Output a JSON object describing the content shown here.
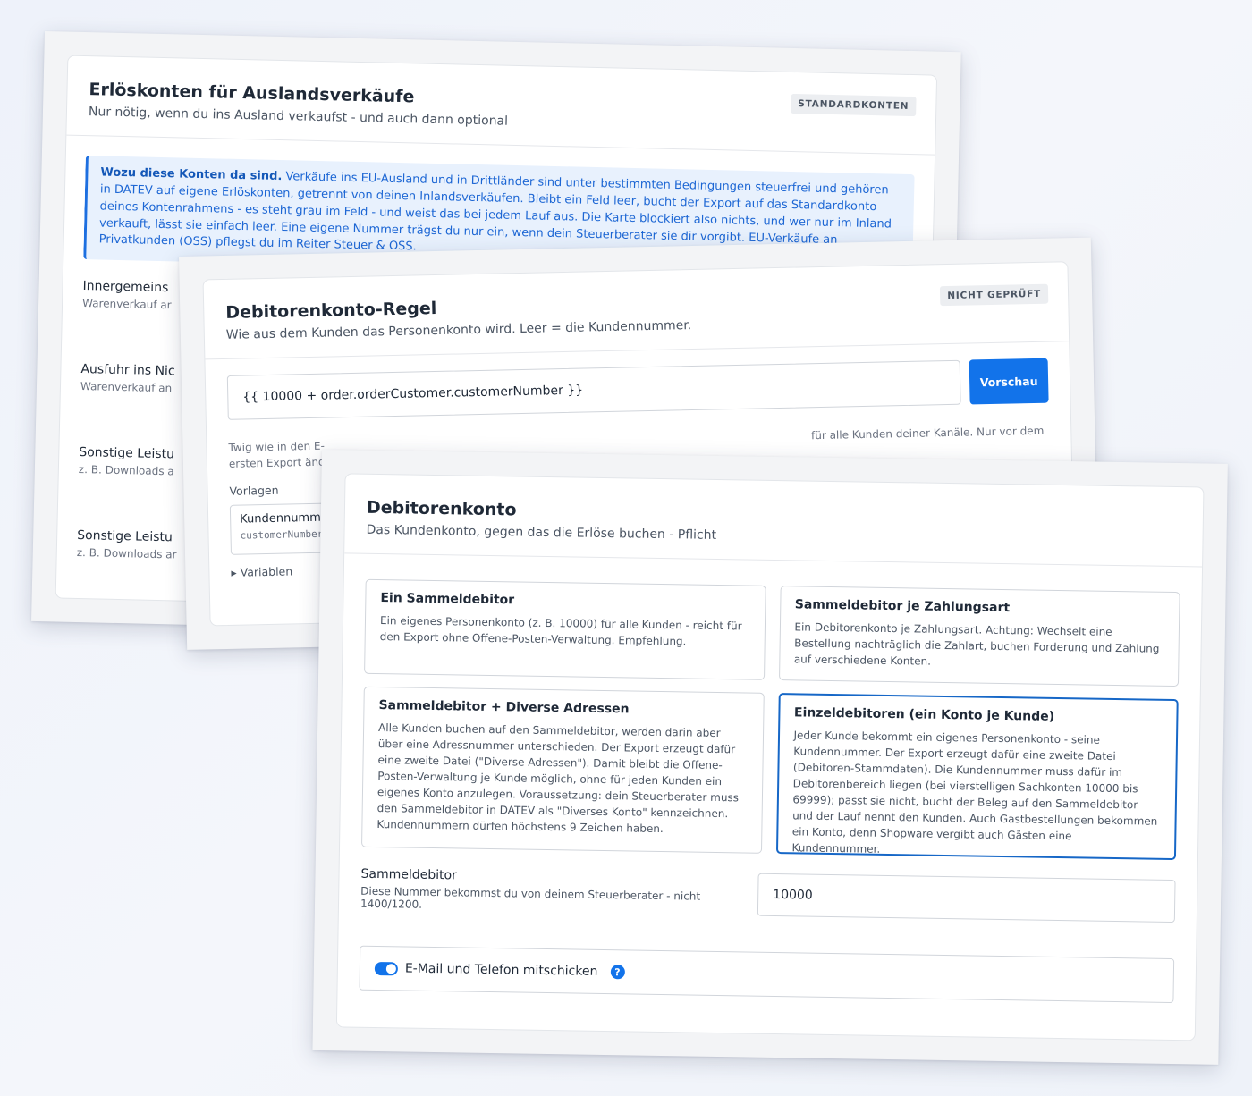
{
  "foreign_accounts": {
    "title": "Erlöskonten für Auslandsverkäufe",
    "subtitle": "Nur nötig, wenn du ins Ausland verkaufst - und auch dann optional",
    "badge": "STANDARDKONTEN",
    "info_bold": "Wozu diese Konten da sind.",
    "info_text": " Verkäufe ins EU-Ausland und in Drittländer sind unter bestimmten Bedingungen steuerfrei und gehören in DATEV auf eigene Erlöskonten, getrennt von deinen Inlandsverkäufen. Bleibt ein Feld leer, bucht der Export auf das Standardkonto deines Kontenrahmens - es steht grau im Feld - und weist das bei jedem Lauf aus. Die Karte blockiert also nichts, und wer nur im Inland verkauft, lässt sie einfach leer. Eine eigene Nummer trägst du nur ein, wenn dein Steuerberater sie dir vorgibt. EU-Verkäufe an Privatkunden (OSS) pflegst du im Reiter Steuer & OSS.",
    "rows": [
      {
        "title": "Innergemeins",
        "sub": "Warenverkauf ar"
      },
      {
        "title": "Ausfuhr ins Nic",
        "sub": "Warenverkauf an"
      },
      {
        "title": "Sonstige Leistu",
        "sub": "z. B. Downloads a"
      },
      {
        "title": "Sonstige Leistu",
        "sub": "z. B. Downloads ar"
      }
    ]
  },
  "debtor_rule": {
    "title": "Debitorenkonto-Regel",
    "subtitle": "Wie aus dem Kunden das Personenkonto wird. Leer = die Kundennummer.",
    "badge": "NICHT GEPRÜFT",
    "rule_value": "{{ 10000 + order.orderCustomer.customerNumber }}",
    "preview_button": "Vorschau",
    "help_line1": "Twig wie in den E-",
    "help_line1_right": "für alle Kunden deiner Kanäle. Nur vor dem",
    "help_line2": "ersten Export ände",
    "templates_label": "Vorlagen",
    "template_name": "Kundennumme",
    "template_code": "customerNumber",
    "variables_toggle": "▸ Variablen"
  },
  "debtor_account": {
    "title": "Debitorenkonto",
    "subtitle": "Das Kundenkonto, gegen das die Erlöse buchen - Pflicht",
    "options": [
      {
        "title": "Ein Sammeldebitor",
        "text": "Ein eigenes Personenkonto (z. B. 10000) für alle Kunden - reicht für den Export ohne Offene-Posten-Verwaltung. Empfehlung.",
        "selected": false
      },
      {
        "title": "Sammeldebitor je Zahlungsart",
        "text": "Ein Debitorenkonto je Zahlungsart. Achtung: Wechselt eine Bestellung nachträglich die Zahlart, buchen Forderung und Zahlung auf verschiedene Konten.",
        "selected": false
      },
      {
        "title": "Sammeldebitor + Diverse Adressen",
        "text": "Alle Kunden buchen auf den Sammeldebitor, werden darin aber über eine Adressnummer unterschieden. Der Export erzeugt dafür eine zweite Datei (\"Diverse Adressen\"). Damit bleibt die Offene-Posten-Verwaltung je Kunde möglich, ohne für jeden Kunden ein eigenes Konto anzulegen. Voraussetzung: dein Steuerberater muss den Sammeldebitor in DATEV als \"Diverses Konto\" kennzeichnen. Kundennummern dürfen höchstens 9 Zeichen haben.",
        "selected": false
      },
      {
        "title": "Einzeldebitoren (ein Konto je Kunde)",
        "text": "Jeder Kunde bekommt ein eigenes Personenkonto - seine Kundennummer. Der Export erzeugt dafür eine zweite Datei (Debitoren-Stammdaten). Die Kundennummer muss dafür im Debitorenbereich liegen (bei vierstelligen Sachkonten 10000 bis 69999); passt sie nicht, bucht der Beleg auf den Sammeldebitor und der Lauf nennt den Kunden. Auch Gastbestellungen bekommen ein Konto, denn Shopware vergibt auch Gästen eine Kundennummer.",
        "selected": true
      }
    ],
    "collective_label": "Sammeldebitor",
    "collective_desc": "Diese Nummer bekommst du von deinem Steuerberater - nicht 1400/1200.",
    "collective_value": "10000",
    "toggle_label": "E-Mail und Telefon mitschicken",
    "toggle_on": true,
    "help_glyph": "?"
  }
}
